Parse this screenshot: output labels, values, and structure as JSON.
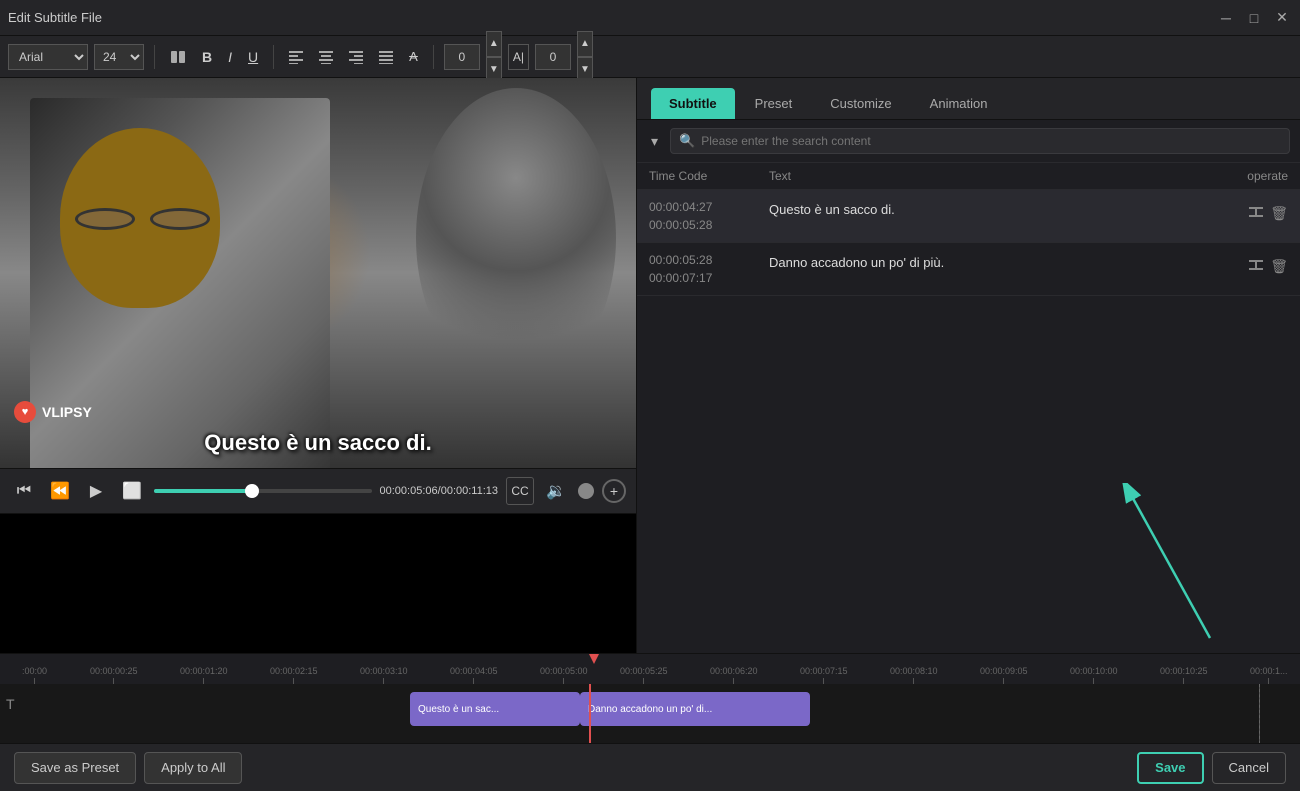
{
  "titlebar": {
    "title": "Edit Subtitle File",
    "minimize": "─",
    "restore": "□",
    "close": "✕"
  },
  "toolbar": {
    "font": "Arial",
    "fontSize": "24",
    "bold": "B",
    "italic": "I",
    "underline": "U",
    "align_left": "≡",
    "align_center": "≡",
    "align_right": "≡",
    "align_justify": "≡",
    "strikethrough": "A",
    "num1": "0",
    "num2": "0"
  },
  "tabs": {
    "subtitle": "Subtitle",
    "preset": "Preset",
    "customize": "Customize",
    "animation": "Animation"
  },
  "search": {
    "placeholder": "Please enter the search content"
  },
  "table": {
    "col_timecode": "Time Code",
    "col_text": "Text",
    "col_operate": "operate"
  },
  "subtitles": [
    {
      "start": "00:00:04:27",
      "end": "00:00:05:28",
      "text": "Questo è un sacco di."
    },
    {
      "start": "00:00:05:28",
      "end": "00:00:07:17",
      "text": "Danno accadono un po' di più."
    }
  ],
  "video": {
    "subtitle_text": "Questo è un sacco di.",
    "watermark": "VLIPSY",
    "time_current": "00:00:05:06",
    "time_total": "00:00:11:13"
  },
  "timeline": {
    "marks": [
      ":00:00",
      "00:00:00:25",
      "00:00:01:20",
      "00:00:02:15",
      "00:00:03:10",
      "00:00:04:05",
      "00:00:05:00",
      "00:00:05:25",
      "00:00:06:20",
      "00:00:07:15",
      "00:00:08:10",
      "00:00:09:05",
      "00:00:10:00",
      "00:00:10:25"
    ],
    "clip1_label": "Questo è un sac...",
    "clip2_label": "Danno accadono un po' di...",
    "t_icon": "T"
  },
  "bottom": {
    "save_preset": "Save as Preset",
    "apply_all": "Apply to All",
    "save": "Save",
    "cancel": "Cancel"
  }
}
